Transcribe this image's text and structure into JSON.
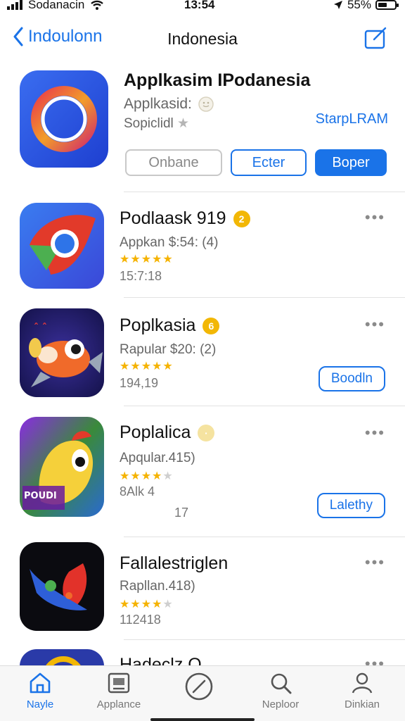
{
  "status": {
    "carrier": "Sodanacin",
    "time": "13:54",
    "battery": "55%",
    "battery_level": 0.55
  },
  "nav": {
    "back_label": "Indoulonn",
    "title": "Indonesia"
  },
  "featured": {
    "name": "Applkasim IPodanesia",
    "sub1": "Applkasid:",
    "sub2": "Sopiclidl",
    "link": "StarpLRAM",
    "buttons": {
      "secondary": "Onbane",
      "outline": "Ecter",
      "primary": "Boper"
    }
  },
  "apps": [
    {
      "name": "Podlaask 919",
      "sub": "Appkan $:54: (4)",
      "rating": 5,
      "count": "15:7:18",
      "action": ""
    },
    {
      "name": "Poplkasia",
      "sub": "Rapular $20: (2)",
      "rating": 5,
      "count": "194,19",
      "action": "Boodln"
    },
    {
      "name": "Poplalica",
      "sub": "Apqular.415)",
      "rating": 4,
      "count": "8Alk 4",
      "extra": "17",
      "action": "Lalethy"
    },
    {
      "name": "Fallalestriglen",
      "sub": "Rapllan.418)",
      "rating": 4,
      "count": "112418",
      "action": ""
    },
    {
      "name": "Hadeclz O",
      "sub": "",
      "rating": 0,
      "count": "",
      "action": ""
    }
  ],
  "tabs": [
    {
      "label": "Nayle",
      "icon": "home-icon"
    },
    {
      "label": "Applance",
      "icon": "apps-icon"
    },
    {
      "label": "",
      "icon": "compass-icon"
    },
    {
      "label": "Neploor",
      "icon": "search-icon"
    },
    {
      "label": "Dinkian",
      "icon": "profile-icon"
    }
  ],
  "colors": {
    "accent": "#1a73e8",
    "star": "#f5b301",
    "badge_gold": "#f2b705"
  },
  "more_label": "•••"
}
